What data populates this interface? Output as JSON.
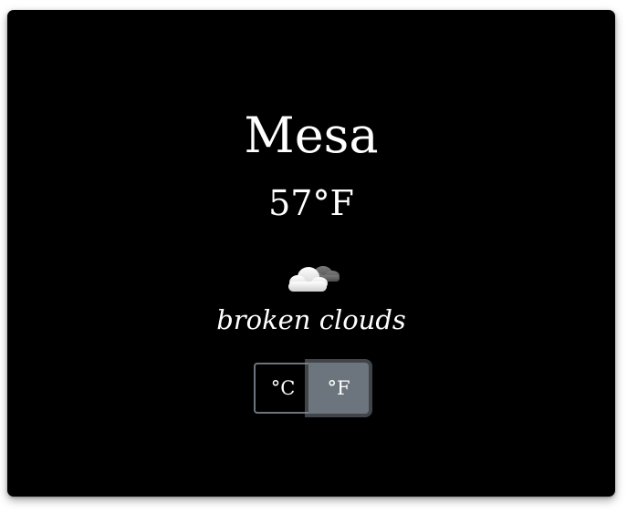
{
  "weather": {
    "city": "Mesa",
    "temperature": "57°F",
    "condition_icon": "broken-clouds-icon",
    "description": "broken clouds"
  },
  "units": {
    "celsius_label": "°C",
    "fahrenheit_label": "°F",
    "selected": "fahrenheit"
  },
  "colors": {
    "card_background": "#000000",
    "text": "#ffffff",
    "toggle_active": "#6c757d"
  }
}
